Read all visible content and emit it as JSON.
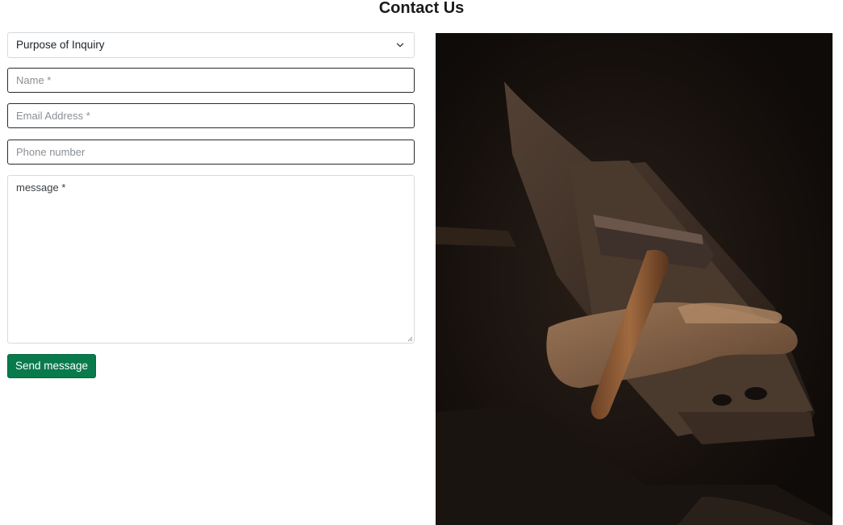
{
  "page": {
    "title": "Contact Us"
  },
  "form": {
    "purpose_select": {
      "selected": "Purpose of Inquiry",
      "icon": "chevron-down-icon"
    },
    "name_field": {
      "placeholder": "Name *",
      "value": ""
    },
    "email_field": {
      "placeholder": "Email Address *",
      "value": ""
    },
    "phone_field": {
      "placeholder": "Phone number",
      "value": ""
    },
    "message_field": {
      "placeholder": "message *",
      "value": ""
    },
    "send_label": "Send message"
  },
  "colors": {
    "button_bg": "#087a4c",
    "button_text": "#ffffff",
    "photo_dark": "#130e0b"
  }
}
